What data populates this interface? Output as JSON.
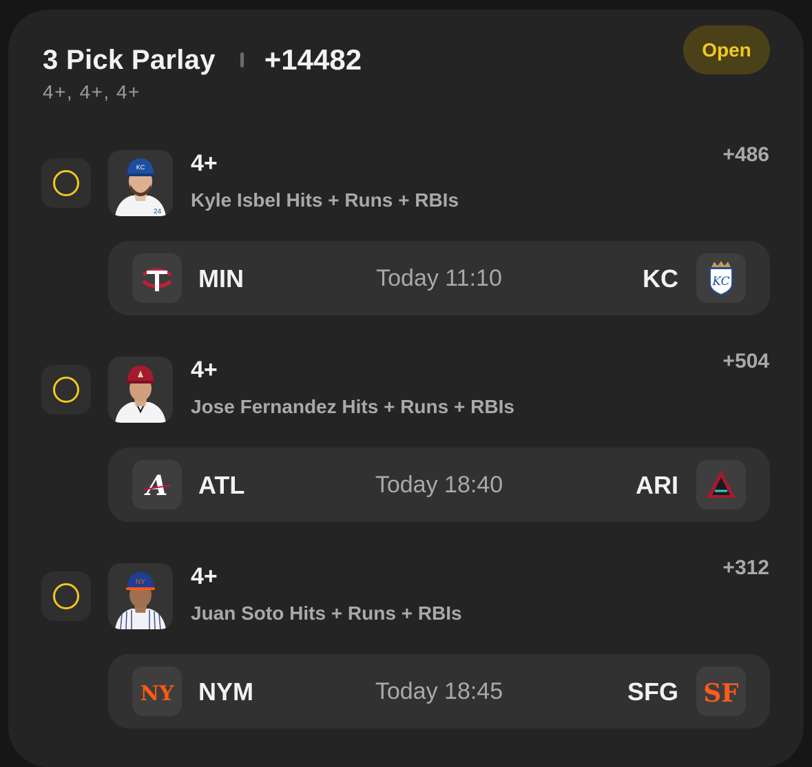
{
  "parlay": {
    "title": "3 Pick Parlay",
    "odds": "+14482",
    "subtitle": "4+, 4+, 4+",
    "status": "Open"
  },
  "legs": [
    {
      "line": "4+",
      "prop": "Kyle Isbel Hits + Runs + RBIs",
      "odds": "+486",
      "away_team": "MIN",
      "home_team": "KC",
      "time": "Today 11:10",
      "away_logo": "twins-logo-icon",
      "home_logo": "royals-logo-icon"
    },
    {
      "line": "4+",
      "prop": "Jose Fernandez Hits + Runs + RBIs",
      "odds": "+504",
      "away_team": "ATL",
      "home_team": "ARI",
      "time": "Today 18:40",
      "away_logo": "braves-logo-icon",
      "home_logo": "diamondbacks-logo-icon"
    },
    {
      "line": "4+",
      "prop": "Juan Soto Hits + Runs + RBIs",
      "odds": "+312",
      "away_team": "NYM",
      "home_team": "SFG",
      "time": "Today 18:45",
      "away_logo": "mets-logo-icon",
      "home_logo": "giants-logo-icon"
    }
  ],
  "colors": {
    "accent": "#f5c81e",
    "card_bg": "#242424",
    "row_bg": "#313131"
  }
}
